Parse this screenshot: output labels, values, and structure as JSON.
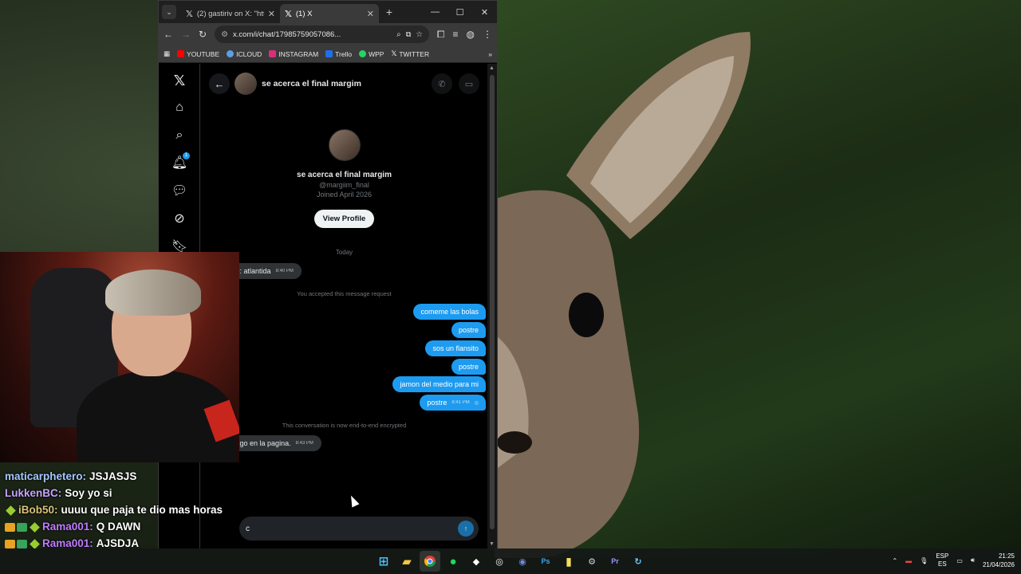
{
  "browser": {
    "tabs": [
      {
        "title": "(2) gastiriv on X: \"https:",
        "active": false
      },
      {
        "title": "(1) X",
        "active": true
      }
    ],
    "url": "x.com/i/chat/17985759057086...",
    "bookmarks": [
      {
        "label": "YOUTUBE",
        "color": "#ff0000"
      },
      {
        "label": "ICLOUD",
        "color": "#5aa0e6"
      },
      {
        "label": "INSTAGRAM",
        "color": "#d6307a"
      },
      {
        "label": "Trello",
        "color": "#1f6feb"
      },
      {
        "label": "WPP",
        "color": "#25d366"
      },
      {
        "label": "TWITTER",
        "color": "#ffffff"
      }
    ]
  },
  "chat": {
    "name": "se acerca el final margim",
    "handle": "@margiim_final",
    "joined": "Joined April 2026",
    "view_profile": "View Profile",
    "day": "Today",
    "system_request": "You accepted this message request",
    "system_encrypted": "This conversation is now end-to-end encrypted",
    "messages_in": [
      {
        "text": "a tu tiempo: atlantida",
        "time": "8:40 PM"
      },
      {
        "text": "Usá el código en la pagina.",
        "time": "8:43 PM"
      }
    ],
    "messages_out": [
      {
        "text": "comeme las bolas",
        "time": ""
      },
      {
        "text": "postre",
        "time": ""
      },
      {
        "text": "sos un flansito",
        "time": ""
      },
      {
        "text": "postre",
        "time": ""
      },
      {
        "text": "jamon del medio para mi",
        "time": ""
      },
      {
        "text": "postre",
        "time": "8:41 PM"
      }
    ],
    "composer_value": "c"
  },
  "twitch_chat": [
    {
      "user": "maticarphetero:",
      "text": "JSJASJS",
      "user_color": "#a6c8ff",
      "badges": []
    },
    {
      "user": "LukkenBC:",
      "text": "Soy yo si",
      "user_color": "#c7a3ff",
      "badges": []
    },
    {
      "user": "iBob50:",
      "text": "uuuu que paja te dio mas horas",
      "user_color": "#d9c27a",
      "badges": [
        "diamond"
      ]
    },
    {
      "user": "Rama001:",
      "text": "Q DAWN",
      "user_color": "#c07cff",
      "badges": [
        "gold",
        "green",
        "diamond"
      ]
    },
    {
      "user": "Rama001:",
      "text": "AJSDJA",
      "user_color": "#c07cff",
      "badges": [
        "gold",
        "green",
        "diamond"
      ]
    }
  ],
  "taskbar": {
    "lang_top": "ESP",
    "lang_bottom": "ES",
    "time": "21:25",
    "date": "21/04/2026",
    "apps": [
      "windows-start",
      "file-explorer",
      "chrome",
      "spotify",
      "app-dark",
      "obs",
      "discord",
      "photoshop",
      "sticky-notes",
      "steam",
      "premiere",
      "refresh-app"
    ]
  },
  "colors": {
    "x_blue": "#1d9bf0",
    "x_bg": "#000000",
    "bubble_in": "#2f3336"
  }
}
